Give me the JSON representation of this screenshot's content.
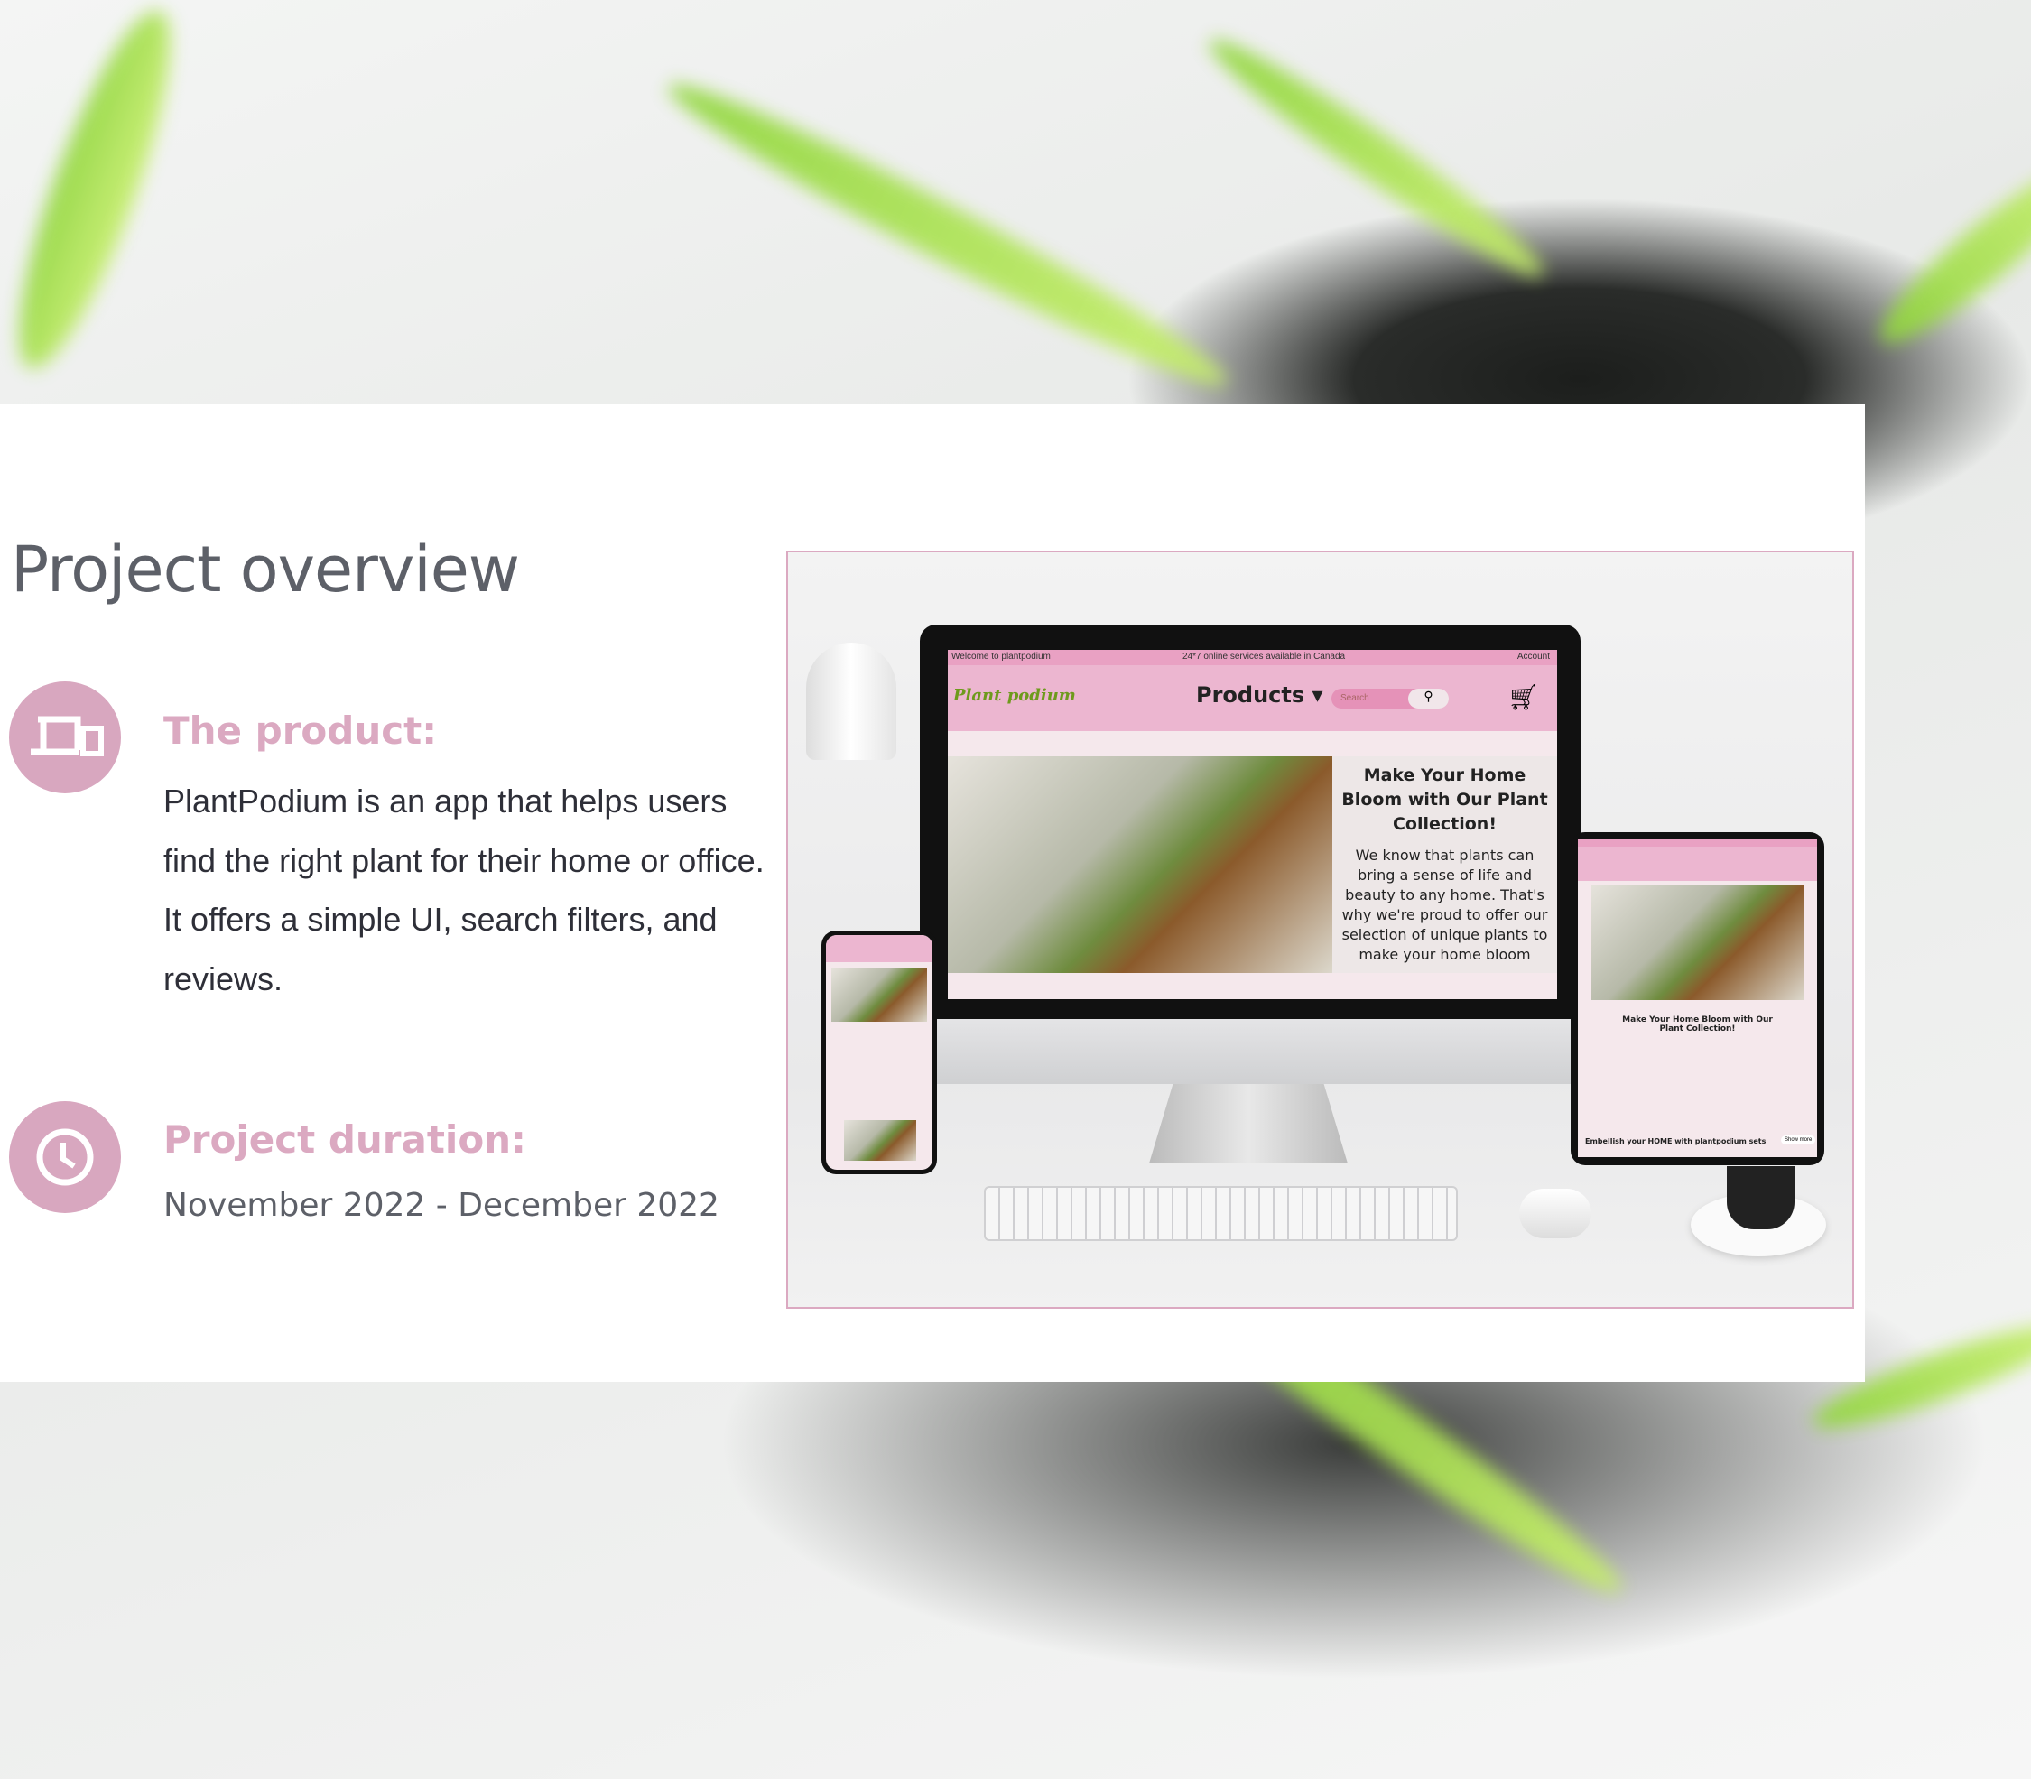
{
  "heading": "Project overview",
  "product": {
    "title": "The product:",
    "icon": "devices-icon",
    "lines": [
      "PlantPodium is an app that helps users",
      "find the right plant for their home or office.",
      "It offers a simple UI, search filters, and",
      "reviews."
    ]
  },
  "duration": {
    "title": "Project duration:",
    "icon": "clock-icon",
    "value": "November 2022 - December 2022"
  },
  "mockup": {
    "topbar_left": "Welcome to plantpodium",
    "topbar_center": "24*7 online services available in Canada",
    "topbar_right": "Account",
    "logo": "Plant podium",
    "nav_products": "Products",
    "search_placeholder": "Search",
    "hero_title": "Make Your Home Bloom with Our Plant Collection!",
    "hero_text": "We know that plants can bring a sense of life and beauty to any home. That's why we're proud to offer our selection of unique plants to make your home bloom",
    "sets_title": "Embellish your HOME with plantpodium sets",
    "show_more": "Show more"
  },
  "colors": {
    "accent": "#d8a7bf",
    "heading_pink": "#dba9c1",
    "site_pink": "#e9a1c3"
  }
}
